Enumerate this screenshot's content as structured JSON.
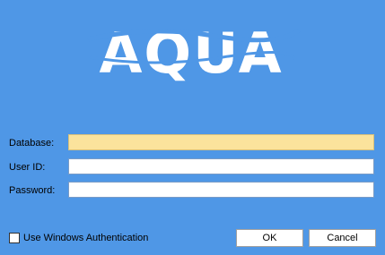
{
  "logo": {
    "text": "AQUA"
  },
  "form": {
    "database_label": "Database:",
    "database_value": "",
    "userid_label": "User ID:",
    "userid_value": "",
    "password_label": "Password:",
    "password_value": ""
  },
  "options": {
    "windows_auth_label": "Use Windows Authentication",
    "windows_auth_checked": false
  },
  "buttons": {
    "ok_label": "OK",
    "cancel_label": "Cancel"
  },
  "colors": {
    "background": "#4f97e6",
    "focused_field": "#fbe39c",
    "logo": "#ffffff"
  }
}
